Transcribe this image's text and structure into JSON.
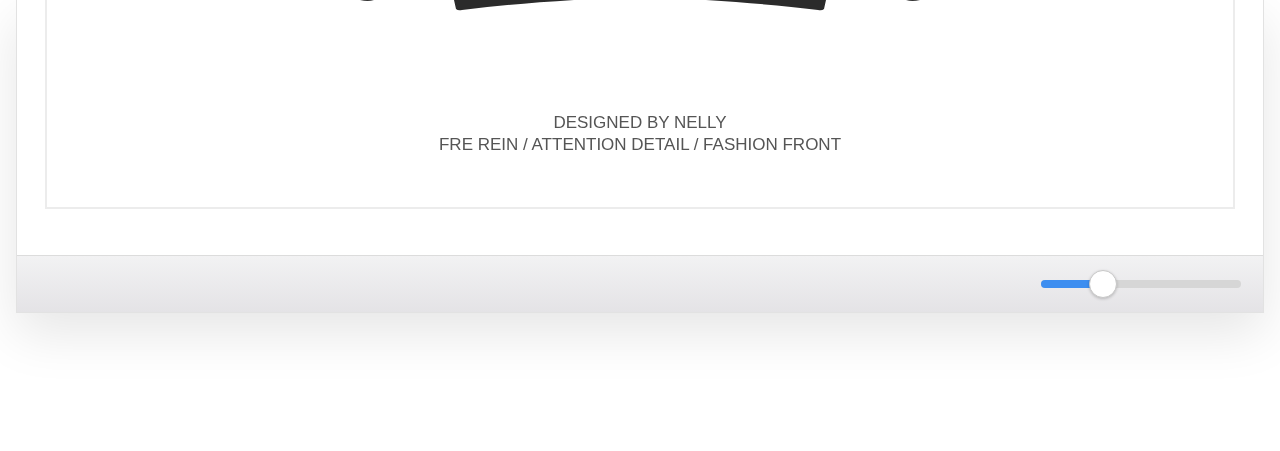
{
  "document": {
    "credit_lines": [
      "DESIGNED BY NELLY",
      "FRE REIN / ATTENTION DETAIL / FASHION FRONT"
    ]
  },
  "toolbar": {
    "zoom_slider": {
      "level": 0.31
    }
  }
}
